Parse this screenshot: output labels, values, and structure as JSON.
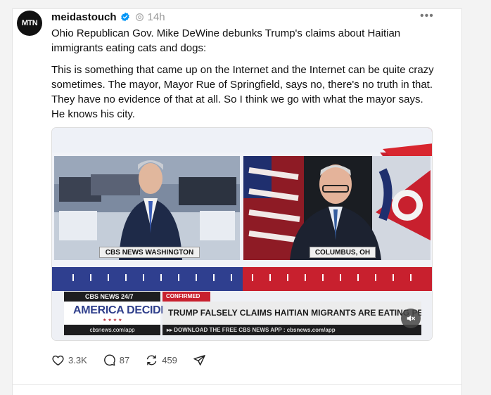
{
  "post": {
    "avatar_text": "MTN",
    "username": "meidastouch",
    "verified_icon": "verified-badge-icon",
    "threads_icon": "threads-icon",
    "time": "14h",
    "more_label": "•••",
    "caption": "Ohio Republican Gov. Mike DeWine debunks Trump's claims about Haitian immigrants eating cats and dogs:",
    "quote": "This is something that came up on the Internet and the Internet can be quite crazy sometimes. The mayor, Mayor Rue of Springfield, says no, there's no truth in that. They have no evidence of that at all. So I think we go with what the mayor says. He knows his city."
  },
  "video": {
    "left_caption": "CBS NEWS WASHINGTON",
    "right_caption": "COLUMBUS, OH",
    "network_tag": "CBS NEWS 24/7",
    "show_title": "AMERICA DECIDES",
    "confirmed_label": "CONFIRMED",
    "headline": "TRUMP FALSELY CLAIMS HAITIAN MIGRANTS ARE EATING PETS IN",
    "site_url": "cbsnews.com/app",
    "download_bar": "▸▸ DOWNLOAD THE FREE CBS NEWS APP : cbsnews.com/app",
    "desk_label": "AMERICA DECIDES"
  },
  "actions": {
    "likes": "3.3K",
    "comments": "87",
    "reposts": "459"
  },
  "colors": {
    "brand_blue": "#2e3e8b",
    "cbs_red": "#c8202e",
    "verified": "#0095f6"
  }
}
